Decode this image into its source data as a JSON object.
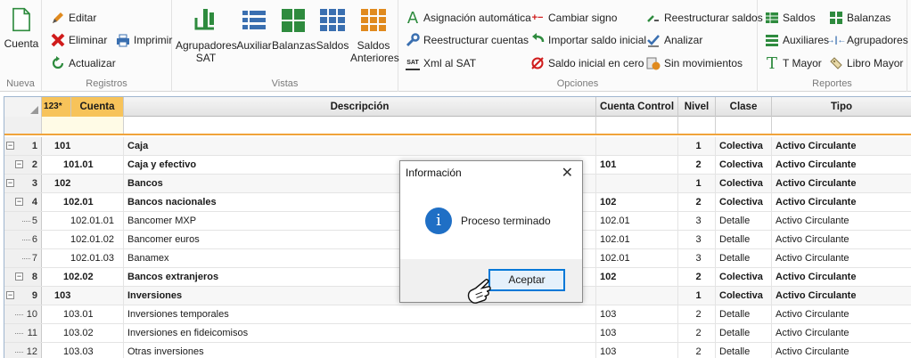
{
  "ribbon": {
    "groups": {
      "nueva": "Nueva",
      "registros": "Registros",
      "vistas": "Vistas",
      "opciones": "Opciones",
      "reportes": "Reportes"
    },
    "buttons": {
      "cuenta": "Cuenta",
      "editar": "Editar",
      "eliminar": "Eliminar",
      "actualizar": "Actualizar",
      "imprimir": "Imprimir",
      "agrupadores_sat_1": "Agrupadores",
      "agrupadores_sat_2": "SAT",
      "auxiliar": "Auxiliar",
      "balanzas": "Balanzas",
      "saldos": "Saldos",
      "saldos_anteriores_1": "Saldos",
      "saldos_anteriores_2": "Anteriores",
      "asignacion": "Asignación automática",
      "reestructurar_cuentas": "Reestructurar cuentas",
      "xml_sat": "Xml al SAT",
      "cambiar_signo": "Cambiar signo",
      "importar_saldo": "Importar saldo inicial",
      "saldo_cero": "Saldo inicial en cero",
      "reestructurar_saldos": "Reestructurar saldos",
      "analizar": "Analizar",
      "sin_movimientos": "Sin movimientos",
      "rep_saldos": "Saldos",
      "rep_balanzas": "Balanzas",
      "rep_auxiliares": "Auxiliares",
      "rep_agrupadores": "Agrupadores",
      "rep_tmayor": "T Mayor",
      "rep_libro_mayor": "Libro Mayor",
      "sat_badge": "SAT"
    }
  },
  "grid": {
    "level_buttons": [
      "1",
      "2",
      "3",
      "*"
    ],
    "columns": {
      "cuenta": "Cuenta",
      "descripcion": "Descripción",
      "cuenta_control": "Cuenta Control",
      "nivel": "Nivel",
      "clase": "Clase",
      "tipo": "Tipo"
    },
    "rows": [
      {
        "num": "1",
        "cuenta": "101",
        "descripcion": "Caja",
        "control": "",
        "nivel": "1",
        "clase": "Colectiva",
        "tipo": "Activo Circulante"
      },
      {
        "num": "2",
        "cuenta": "101.01",
        "descripcion": "Caja y efectivo",
        "control": "101",
        "nivel": "2",
        "clase": "Colectiva",
        "tipo": "Activo Circulante"
      },
      {
        "num": "3",
        "cuenta": "102",
        "descripcion": "Bancos",
        "control": "",
        "nivel": "1",
        "clase": "Colectiva",
        "tipo": "Activo Circulante"
      },
      {
        "num": "4",
        "cuenta": "102.01",
        "descripcion": "Bancos nacionales",
        "control": "102",
        "nivel": "2",
        "clase": "Colectiva",
        "tipo": "Activo Circulante"
      },
      {
        "num": "5",
        "cuenta": "102.01.01",
        "descripcion": "Bancomer MXP",
        "control": "102.01",
        "nivel": "3",
        "clase": "Detalle",
        "tipo": "Activo Circulante"
      },
      {
        "num": "6",
        "cuenta": "102.01.02",
        "descripcion": "Bancomer euros",
        "control": "102.01",
        "nivel": "3",
        "clase": "Detalle",
        "tipo": "Activo Circulante"
      },
      {
        "num": "7",
        "cuenta": "102.01.03",
        "descripcion": "Banamex",
        "control": "102.01",
        "nivel": "3",
        "clase": "Detalle",
        "tipo": "Activo Circulante"
      },
      {
        "num": "8",
        "cuenta": "102.02",
        "descripcion": "Bancos extranjeros",
        "control": "102",
        "nivel": "2",
        "clase": "Colectiva",
        "tipo": "Activo Circulante"
      },
      {
        "num": "9",
        "cuenta": "103",
        "descripcion": "Inversiones",
        "control": "",
        "nivel": "1",
        "clase": "Colectiva",
        "tipo": "Activo Circulante"
      },
      {
        "num": "10",
        "cuenta": "103.01",
        "descripcion": "Inversiones temporales",
        "control": "103",
        "nivel": "2",
        "clase": "Detalle",
        "tipo": "Activo Circulante"
      },
      {
        "num": "11",
        "cuenta": "103.02",
        "descripcion": "Inversiones en fideicomisos",
        "control": "103",
        "nivel": "2",
        "clase": "Detalle",
        "tipo": "Activo Circulante"
      },
      {
        "num": "12",
        "cuenta": "103.03",
        "descripcion": "Otras inversiones",
        "control": "103",
        "nivel": "2",
        "clase": "Detalle",
        "tipo": "Activo Circulante"
      }
    ]
  },
  "dialog": {
    "title": "Información",
    "message": "Proceso terminado",
    "ok_label": "Aceptar",
    "close_glyph": "✕",
    "info_glyph": "i"
  },
  "colors": {
    "accent_orange": "#f0a33a",
    "dialog_blue": "#0078d7",
    "info_icon": "#1f6fc5"
  }
}
